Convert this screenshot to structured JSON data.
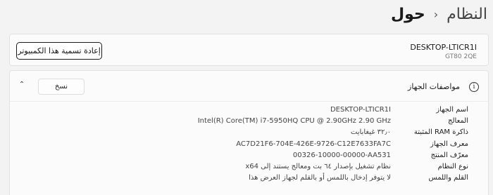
{
  "breadcrumb": {
    "parent": "النظام",
    "current": "حول"
  },
  "device": {
    "name": "DESKTOP-LTICR1I",
    "model": "GT80 2QE",
    "rename_label": "إعادة تسمية هذا الكمبيوتر"
  },
  "specs": {
    "title": "مواصفات الجهاز",
    "copy_label": "نسخ",
    "rows": [
      {
        "label": "اسم الجهاز",
        "value": "DESKTOP-LTICR1I"
      },
      {
        "label": "المعالج",
        "value": "Intel(R) Core(TM) i7-5950HQ CPU @ 2.90GHz   2.90 GHz"
      },
      {
        "label": "ذاكرة RAM المثبتة",
        "value": "٣٢٫٠ غيغابايت"
      },
      {
        "label": "معرف الجهاز",
        "value": "AC7D21F6-704E-426E-9726-C12E7633FA7C"
      },
      {
        "label": "معرّف المنتج",
        "value": "00326-10000-00000-AA531"
      },
      {
        "label": "نوع النظام",
        "value": "نظام تشغيل بإصدار ٦٤ بت ومعالج يستند إلى x64"
      },
      {
        "label": "القلم واللمس",
        "value": "لا يتوفر إدخال باللمس أو بالقلم لجهاز العرض هذا"
      }
    ]
  }
}
